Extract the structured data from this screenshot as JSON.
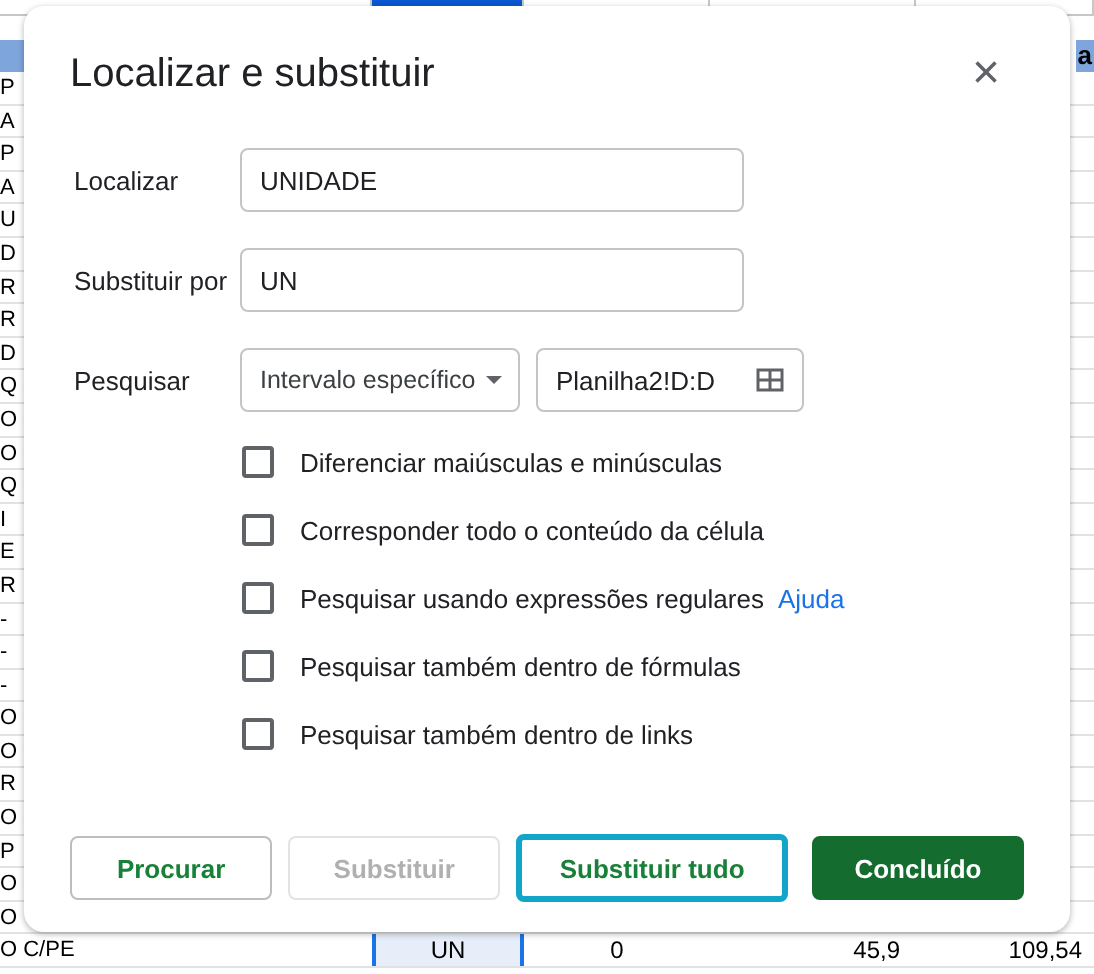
{
  "sheet": {
    "header_fragment": "a",
    "rows": [
      {
        "cells": [
          "P"
        ]
      },
      {
        "cells": [
          "A"
        ]
      },
      {
        "cells": [
          "P"
        ]
      },
      {
        "cells": [
          "A"
        ]
      },
      {
        "cells": [
          "U"
        ]
      },
      {
        "cells": [
          "D"
        ]
      },
      {
        "cells": [
          "R"
        ]
      },
      {
        "cells": [
          "R"
        ]
      },
      {
        "cells": [
          "D"
        ]
      },
      {
        "cells": [
          "Q"
        ]
      },
      {
        "cells": [
          "O"
        ]
      },
      {
        "cells": [
          "O"
        ]
      },
      {
        "cells": [
          "Q"
        ]
      },
      {
        "cells": [
          "I"
        ]
      },
      {
        "cells": [
          "E"
        ]
      },
      {
        "cells": [
          "R"
        ]
      },
      {
        "cells": [
          "-"
        ]
      },
      {
        "cells": [
          "-"
        ]
      },
      {
        "cells": [
          "-"
        ]
      },
      {
        "cells": [
          "O"
        ]
      },
      {
        "cells": [
          "O"
        ]
      },
      {
        "cells": [
          "R"
        ]
      },
      {
        "cells": [
          "O"
        ]
      },
      {
        "cells": [
          "P"
        ]
      },
      {
        "cells": [
          "O"
        ]
      },
      {
        "cells": [
          "O"
        ]
      },
      {
        "cells": [
          "O C/PE",
          "UN",
          "0",
          "45,9",
          "109,54"
        ]
      }
    ]
  },
  "dialog": {
    "title": "Localizar e substituir",
    "close": "×",
    "fields": [
      {
        "label": "Localizar",
        "value": "UNIDADE"
      },
      {
        "label": "Substituir por",
        "value": "UN"
      }
    ],
    "search": {
      "label": "Pesquisar",
      "dropdown": "Intervalo específico",
      "range": "Planilha2!D:D"
    },
    "options": [
      {
        "label": "Diferenciar maiúsculas e minúsculas",
        "checked": false
      },
      {
        "label": "Corresponder todo o conteúdo da célula",
        "checked": false
      },
      {
        "label": "Pesquisar usando expressões regulares",
        "checked": false,
        "link": "Ajuda"
      },
      {
        "label": "Pesquisar também dentro de fórmulas",
        "checked": false
      },
      {
        "label": "Pesquisar também dentro de links",
        "checked": false
      }
    ],
    "buttons": [
      {
        "label": "Procurar",
        "kind": "outlined",
        "disabled": false
      },
      {
        "label": "Substituir",
        "kind": "outlined",
        "disabled": true
      },
      {
        "label": "Substituir tudo",
        "kind": "focused",
        "disabled": false
      },
      {
        "label": "Concluído",
        "kind": "primary",
        "disabled": false
      }
    ]
  }
}
